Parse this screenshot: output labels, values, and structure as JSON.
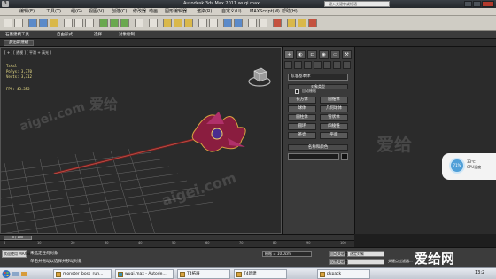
{
  "window": {
    "title": "Autodesk 3ds Max 2011    wuqi.max",
    "logo_text": "3",
    "search_placeholder": "键入关键字或短语"
  },
  "menu": [
    "编辑(E)",
    "工具(T)",
    "组(G)",
    "视图(V)",
    "创建(C)",
    "修改器",
    "动画",
    "图形编辑器",
    "渲染(R)",
    "自定义(U)",
    "MAXScript(M)",
    "帮助(H)"
  ],
  "ribbon": {
    "tabs": [
      "石墨建模工具",
      "自由形式",
      "选择",
      "对象绘制"
    ],
    "subtab": "多边形建模"
  },
  "viewport": {
    "label": "[ + ] [ 透视 ] [ 平滑 + 高光 ]",
    "stats_total": "Total",
    "stats_polys": "Polys:  3,370",
    "stats_verts": "Verts:  3,312",
    "stats_fps": "FPS:   43.352"
  },
  "command_panel": {
    "tab_icons": [
      "+",
      "◐",
      "⊏",
      "◉",
      "▭",
      "⚒"
    ],
    "dropdown": "标准基本体",
    "rollout_object_type": "对象类型",
    "autogrid": "自动栅格",
    "primitives": [
      "长方体",
      "圆锥体",
      "球体",
      "几何球体",
      "圆柱体",
      "管状体",
      "圆环",
      "四棱锥",
      "茶壶",
      "平面"
    ],
    "rollout_name_color": "名称和颜色"
  },
  "gauge": {
    "value": "71%",
    "line1": "33℃",
    "line2": "CPU温度"
  },
  "timeline": {
    "slider": "0 / 100",
    "ticks": [
      "0",
      "10",
      "20",
      "30",
      "40",
      "50",
      "60",
      "70",
      "80",
      "90",
      "100"
    ]
  },
  "status": {
    "left_label": "欢迎使用 MAXSc",
    "message1": "未选定任何对象",
    "message2": "单击并拖动以选择并移动对象",
    "coord": "栅格 = 10.0cm",
    "auto_key": "自动关键点",
    "set_key": "设置关键点",
    "selection": "选定对象",
    "key_filters": "关键点过滤器..."
  },
  "brand_logo": "爱给网",
  "watermarks": [
    "爱给",
    "aigei.com"
  ],
  "taskbar": {
    "start": "",
    "tasks": [
      "monster_boss_run...",
      "wuqi.max - Autode...",
      "T4拓展",
      "T4新建",
      "pkpack"
    ],
    "clock": "13:2"
  }
}
